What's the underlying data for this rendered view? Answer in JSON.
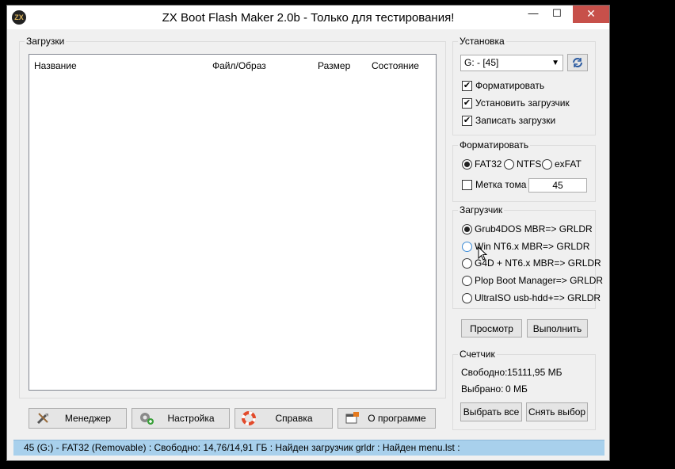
{
  "window": {
    "title": "ZX Boot Flash Maker 2.0b - Только для тестирования!",
    "icon_text": "ZX",
    "minimize": "—",
    "maximize": "☐",
    "close": "✕"
  },
  "downloads": {
    "group_label": "Загрузки",
    "columns": [
      "Название",
      "Файл/Образ",
      "Размер",
      "Состояние"
    ],
    "rows": []
  },
  "bottom_buttons": {
    "manager": "Менеджер",
    "settings": "Настройка",
    "help": "Справка",
    "about": "О программе"
  },
  "install": {
    "group_label": "Установка",
    "drive_selected": "G: - [45]",
    "format_label": "Форматировать",
    "format_checked": true,
    "install_loader_label": "Установить загрузчик",
    "install_loader_checked": true,
    "write_loads_label": "Записать загрузки",
    "write_loads_checked": true
  },
  "format": {
    "group_label": "Форматировать",
    "options": [
      "FAT32",
      "NTFS",
      "exFAT"
    ],
    "selected": "FAT32",
    "volume_label_text": "Метка тома",
    "volume_label_checked": false,
    "volume_label_value": "45"
  },
  "loader": {
    "group_label": "Загрузчик",
    "options": [
      "Grub4DOS MBR=> GRLDR",
      "Win NT6.x MBR=> GRLDR",
      "G4D + NT6.x MBR=> GRLDR",
      "Plop Boot Manager=> GRLDR",
      "UltraISO usb-hdd+=> GRLDR"
    ],
    "selected": "Grub4DOS MBR=> GRLDR"
  },
  "actions": {
    "view": "Просмотр",
    "execute": "Выполнить"
  },
  "counter": {
    "group_label": "Счетчик",
    "free_label": "Свободно:",
    "free_value": "15111,95 МБ",
    "selected_label": "Выбрано:",
    "selected_value": "0 МБ",
    "select_all": "Выбрать все",
    "deselect": "Снять выбор"
  },
  "status": {
    "text": "45 (G:) - FAT32 (Removable)  :  Свободно: 14,76/14,91 ГБ  :  Найден загрузчик grldr  :  Найден menu.lst  :"
  }
}
